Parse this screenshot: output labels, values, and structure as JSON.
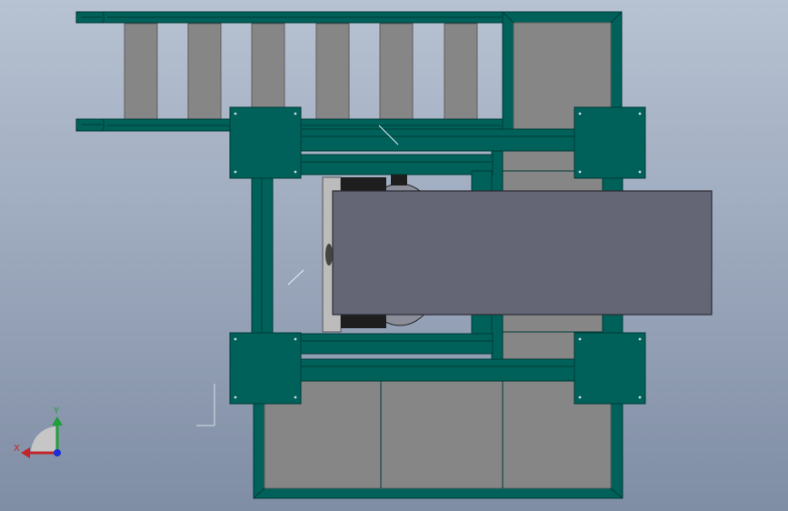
{
  "viewport": {
    "background_top": "#b7c2d2",
    "background_bottom": "#7f8da5"
  },
  "colors": {
    "frame": "#00605a",
    "frame_dark": "#003b37",
    "panel": "#868686",
    "panel_dark": "#5d5d5d",
    "cover": "#646676",
    "cover_edge": "#2b2b33",
    "motor_light": "#c9c9c9",
    "motor_dark": "#1e1e1e"
  },
  "triad": {
    "x_label": "X",
    "y_label": "Y",
    "x_color": "#c0262b",
    "y_color": "#1f9e3a",
    "z_color": "#1a2fd6",
    "icon": "coordinate-triad-icon"
  }
}
